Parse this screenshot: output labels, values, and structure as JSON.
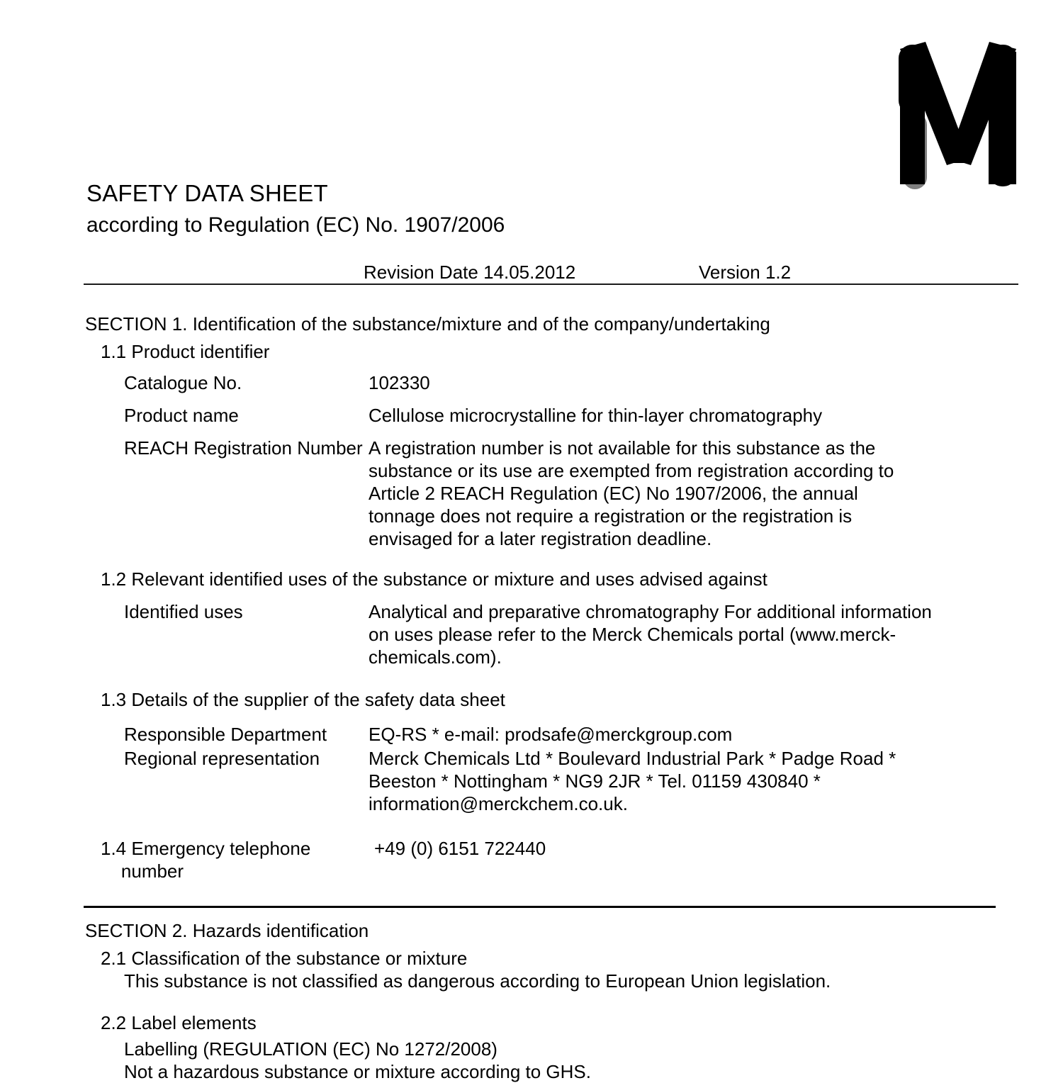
{
  "logo": {
    "name": "merck-m-logo",
    "letter": "M",
    "accent_color": "#808080",
    "mark_color": "#000000"
  },
  "header": {
    "title": "SAFETY DATA SHEET",
    "subtitle": "according to Regulation (EC) No. 1907/2006",
    "revision_date": "Revision Date 14.05.2012",
    "version": "Version 1.2"
  },
  "section1": {
    "heading": "SECTION 1. Identification of the substance/mixture and of the company/undertaking",
    "sub1_heading": "1.1 Product identifier",
    "catalogue_label": "Catalogue No.",
    "catalogue_value": "102330",
    "product_label": "Product name",
    "product_value": "Cellulose microcrystalline for thin-layer chromatography",
    "reach_label": "REACH Registration Number",
    "reach_value": "A registration number is not available for this substance as the substance or its use are exempted from registration according to Article 2 REACH Regulation (EC) No 1907/2006, the annual tonnage does not require a registration or the registration is envisaged for a later registration deadline.",
    "sub2_heading": "1.2 Relevant identified uses of the substance or mixture and uses advised against",
    "uses_label": "Identified uses",
    "uses_value": "Analytical and preparative chromatography\nFor additional information on uses please refer to the Merck Chemicals portal (www.merck-chemicals.com).",
    "sub3_heading": "1.3 Details of the supplier of the safety data sheet",
    "responsible_label": "Responsible Department",
    "responsible_value": "EQ-RS * e-mail: prodsafe@merckgroup.com",
    "regional_label": "Regional representation",
    "regional_value": "Merck Chemicals Ltd * Boulevard Industrial Park * Padge Road * Beeston * Nottingham * NG9 2JR * Tel. 01159 430840 * information@merckchem.co.uk.",
    "emergency_label": "1.4 Emergency telephone\n    number",
    "emergency_value": "+49 (0) 6151 722440"
  },
  "section2": {
    "heading": "SECTION 2. Hazards identification",
    "sub1_heading": "2.1 Classification of the substance or mixture",
    "sub1_body": "This substance is not classified as dangerous according to European Union legislation.",
    "sub2_heading": "2.2 Label elements",
    "labelling_heading": "Labelling (REGULATION (EC) No 1272/2008)",
    "labelling_body": "Not a hazardous substance or mixture according to GHS."
  }
}
